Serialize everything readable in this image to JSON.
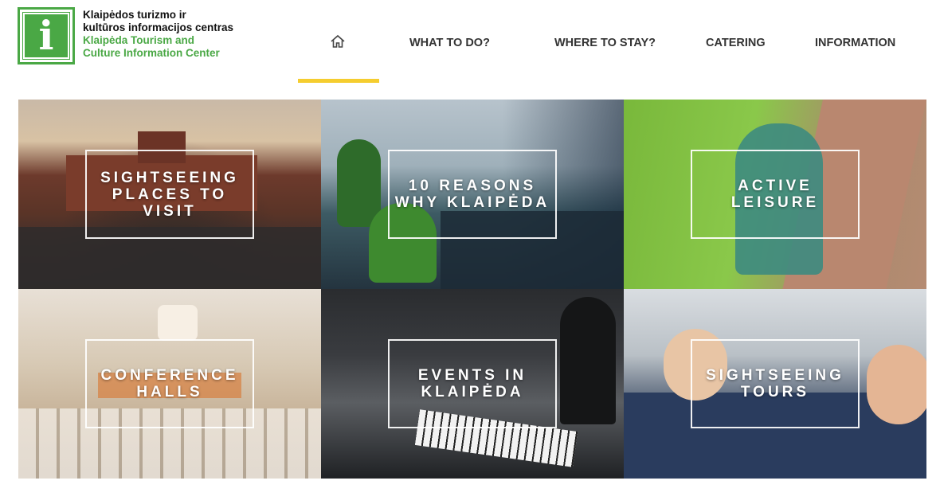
{
  "logo": {
    "icon_letter": "i",
    "lines_lt": [
      "Klaipėdos turizmo ir",
      "kultūros informacijos centras"
    ],
    "lines_en": [
      "Klaipėda Tourism and",
      "Culture Information Center"
    ]
  },
  "nav": {
    "home_icon": "home-icon",
    "items": [
      "WHAT TO DO?",
      "WHERE TO STAY?",
      "CATERING",
      "INFORMATION"
    ]
  },
  "tiles": [
    {
      "label": "SIGHTSEEING PLACES TO VISIT"
    },
    {
      "label": "10 REASONS WHY KLAIPĖDA"
    },
    {
      "label": "ACTIVE LEISURE"
    },
    {
      "label": "CONFERENCE HALLS"
    },
    {
      "label": "EVENTS IN KLAIPĖDA"
    },
    {
      "label": "SIGHTSEEING TOURS"
    }
  ],
  "colors": {
    "brand_green": "#4aa845",
    "active_yellow": "#f5cd2f"
  }
}
